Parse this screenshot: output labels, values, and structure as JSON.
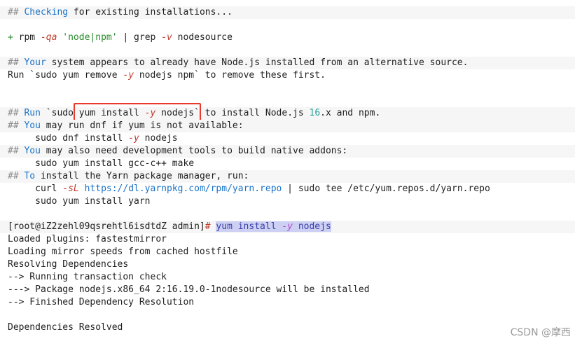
{
  "lines": [
    {
      "p1": "## ",
      "p2": "Checking",
      "p3": " for existing installations..."
    },
    {
      "a": "+ ",
      "b": "rpm ",
      "c": "-qa",
      "d": " ",
      "e": "'node|npm'",
      "f": " | grep ",
      "g": "-v",
      "h": " nodesource"
    },
    {
      "p1": "## ",
      "p2": "Your",
      "p3": " system appears to already have Node.js installed from an alternative source."
    },
    {
      "t": "Run `sudo yum remove ",
      "o": "-y",
      "t2": " nodejs npm` to remove these first."
    },
    {
      "p1": "## ",
      "p2": "Run",
      "p3": " `sudo ",
      "cmd": "yum install ",
      "opt": "-y",
      "cmd2": " nodejs",
      "p4": "` to install Node.js ",
      "ver": "16",
      "p5": ".x and npm."
    },
    {
      "p1": "## ",
      "p2": "You",
      "p3": " may run dnf if yum is not available:"
    },
    {
      "t": "     sudo dnf install ",
      "o": "-y",
      "t2": " nodejs"
    },
    {
      "p1": "## ",
      "p2": "You",
      "p3": " may also need development tools to build native addons:"
    },
    {
      "t": "     sudo yum install gcc-c++ make"
    },
    {
      "p1": "## ",
      "p2": "To",
      "p3": " install the Yarn package manager, run:"
    },
    {
      "t": "     curl ",
      "o": "-sL",
      "url": " https://dl.yarnpkg.com/rpm/yarn.repo",
      "t2": " | sudo tee /etc/yum.repos.d/yarn.repo"
    },
    {
      "t": "     sudo yum install yarn"
    },
    {
      "prompt": "[root@iZ2zehl09qsrehtl6isdtdZ admin]",
      "hash": "# ",
      "sel1": "yum install ",
      "selopt": "-y",
      "sel2": " nodejs"
    },
    {
      "t": "Loaded plugins: fastestmirror"
    },
    {
      "t": "Loading mirror speeds from cached hostfile"
    },
    {
      "t": "Resolving Dependencies"
    },
    {
      "t": "--> Running transaction check"
    },
    {
      "t": "---> Package nodejs.x86_64 2:16.19.0-1nodesource will be installed"
    },
    {
      "t": "--> Finished Dependency Resolution"
    },
    {
      "t": "Dependencies Resolved"
    }
  ],
  "watermark": "CSDN @\u0000\u0000摩\u0000西\u0000\u0000",
  "watermark_text": "CSDN @󠀠󠀠摩󠀠西󠀠󠀠"
}
